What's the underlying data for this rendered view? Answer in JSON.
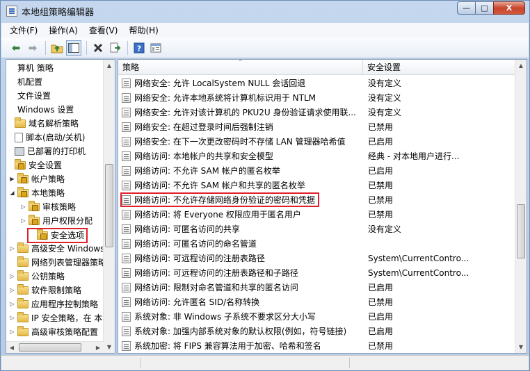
{
  "window": {
    "title": "本地组策略编辑器",
    "minimize": "—",
    "maximize": "□",
    "close": "X"
  },
  "menu": [
    "文件(F)",
    "操作(A)",
    "查看(V)",
    "帮助(H)"
  ],
  "toolbar": {
    "icons": [
      "back-icon",
      "forward-icon",
      "up-folder-icon",
      "show-hide-tree-icon",
      "delete-icon",
      "export-list-icon",
      "help-icon",
      "properties-icon"
    ]
  },
  "tree": [
    {
      "label": "算机 策略",
      "indent": 0,
      "icon": "none",
      "expander": ""
    },
    {
      "label": "机配置",
      "indent": 0,
      "icon": "none",
      "expander": ""
    },
    {
      "label": "文件设置",
      "indent": 0,
      "icon": "none",
      "expander": ""
    },
    {
      "label": "Windows 设置",
      "indent": 0,
      "icon": "none",
      "expander": ""
    },
    {
      "label": "域名解析策略",
      "indent": 1,
      "icon": "folder",
      "expander": ""
    },
    {
      "label": "脚本(启动/关机)",
      "indent": 1,
      "icon": "doc",
      "expander": ""
    },
    {
      "label": "已部署的打印机",
      "indent": 1,
      "icon": "printer",
      "expander": ""
    },
    {
      "label": "安全设置",
      "indent": 1,
      "icon": "folder-lock",
      "expander": ""
    },
    {
      "label": "帐户策略",
      "indent": 2,
      "icon": "folder-lock",
      "expander": "▶"
    },
    {
      "label": "本地策略",
      "indent": 2,
      "icon": "folder-lock",
      "expander": "◢"
    },
    {
      "label": "审核策略",
      "indent": 3,
      "icon": "folder-lock",
      "expander": "▷"
    },
    {
      "label": "用户权限分配",
      "indent": 3,
      "icon": "folder-lock",
      "expander": "▷"
    },
    {
      "label": "安全选项",
      "indent": 3,
      "icon": "folder-lock",
      "expander": "",
      "selected": true
    },
    {
      "label": "高级安全 Windows",
      "indent": 2,
      "icon": "folder",
      "expander": "▷"
    },
    {
      "label": "网络列表管理器策略",
      "indent": 2,
      "icon": "folder",
      "expander": ""
    },
    {
      "label": "公钥策略",
      "indent": 2,
      "icon": "folder",
      "expander": "▷"
    },
    {
      "label": "软件限制策略",
      "indent": 2,
      "icon": "folder",
      "expander": "▷"
    },
    {
      "label": "应用程序控制策略",
      "indent": 2,
      "icon": "folder",
      "expander": "▷"
    },
    {
      "label": "IP 安全策略，在 本",
      "indent": 2,
      "icon": "folder",
      "expander": "▷"
    },
    {
      "label": "高级审核策略配置",
      "indent": 2,
      "icon": "folder",
      "expander": "▷"
    }
  ],
  "list": {
    "headers": {
      "policy": "策略",
      "setting": "安全设置"
    },
    "rows": [
      {
        "policy": "网络安全: 允许 LocalSystem NULL 会话回退",
        "setting": "没有定义"
      },
      {
        "policy": "网络安全: 允许本地系统将计算机标识用于 NTLM",
        "setting": "没有定义"
      },
      {
        "policy": "网络安全: 允许对该计算机的 PKU2U 身份验证请求使用联...",
        "setting": "没有定义"
      },
      {
        "policy": "网络安全: 在超过登录时间后强制注销",
        "setting": "已禁用"
      },
      {
        "policy": "网络安全: 在下一次更改密码时不存储 LAN 管理器哈希值",
        "setting": "已启用"
      },
      {
        "policy": "网络访问: 本地帐户的共享和安全模型",
        "setting": "经典 - 对本地用户进行..."
      },
      {
        "policy": "网络访问: 不允许 SAM 帐户的匿名枚举",
        "setting": "已启用"
      },
      {
        "policy": "网络访问: 不允许 SAM 帐户和共享的匿名枚举",
        "setting": "已禁用"
      },
      {
        "policy": "网络访问: 不允许存储网络身份验证的密码和凭据",
        "setting": "已禁用",
        "highlighted": true
      },
      {
        "policy": "网络访问: 将 Everyone 权限应用于匿名用户",
        "setting": "已禁用"
      },
      {
        "policy": "网络访问: 可匿名访问的共享",
        "setting": "没有定义"
      },
      {
        "policy": "网络访问: 可匿名访问的命名管道",
        "setting": ""
      },
      {
        "policy": "网络访问: 可远程访问的注册表路径",
        "setting": "System\\CurrentContro..."
      },
      {
        "policy": "网络访问: 可远程访问的注册表路径和子路径",
        "setting": "System\\CurrentContro..."
      },
      {
        "policy": "网络访问: 限制对命名管道和共享的匿名访问",
        "setting": "已启用"
      },
      {
        "policy": "网络访问: 允许匿名 SID/名称转换",
        "setting": "已禁用"
      },
      {
        "policy": "系统对象: 非 Windows 子系统不要求区分大小写",
        "setting": "已启用"
      },
      {
        "policy": "系统对象: 加强内部系统对象的默认权限(例如，符号链接)",
        "setting": "已启用"
      },
      {
        "policy": "系统加密: 将 FIPS 兼容算法用于加密、哈希和签名",
        "setting": "已禁用"
      }
    ]
  }
}
